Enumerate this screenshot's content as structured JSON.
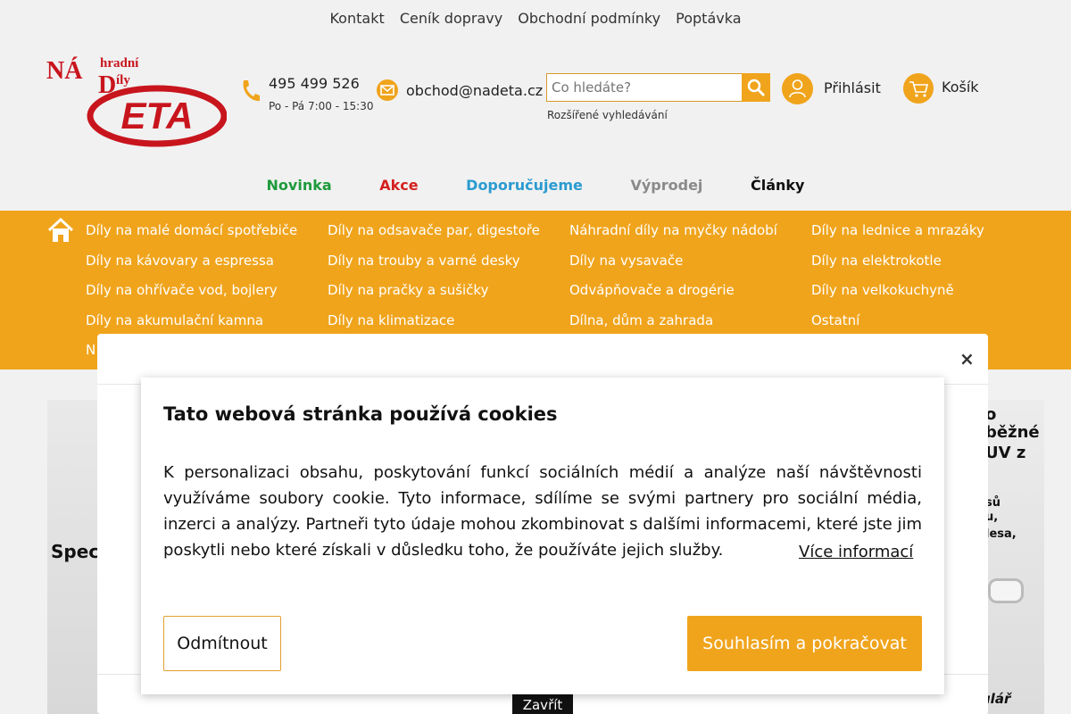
{
  "top_links": [
    "Kontakt",
    "Ceník dopravy",
    "Obchodní podmínky",
    "Poptávka"
  ],
  "logo": {
    "line1": "NÁ",
    "line2": "hradní",
    "line3": "D",
    "line4": "íly",
    "brand": "ETA"
  },
  "contact": {
    "phone": "495 499 526",
    "hours": "Po - Pá 7:00 - 15:30",
    "email": "obchod@nadeta.cz"
  },
  "search": {
    "placeholder": "Co hledáte?",
    "advanced": "Rozšířené vyhledávání"
  },
  "account": {
    "login": "Přihlásit",
    "cart": "Košík"
  },
  "nav": [
    {
      "label": "Novinka",
      "color": "#1e9a3c"
    },
    {
      "label": "Akce",
      "color": "#d52020"
    },
    {
      "label": "Doporučujeme",
      "color": "#2a9bd0"
    },
    {
      "label": "Výprodej",
      "color": "#8a8a8a"
    },
    {
      "label": "Články",
      "color": "#111111"
    }
  ],
  "categories": [
    [
      "Díly na malé domácí spotřebiče",
      "Díly na kávovary a espressa",
      "Díly na ohřívače vod, bojlery",
      "Díly na akumulační kamna",
      "N"
    ],
    [
      "Díly na odsavače par, digestoře",
      "Díly na trouby a varné desky",
      "Díly na pračky a sušičky",
      "Díly na klimatizace"
    ],
    [
      "Náhradní díly na myčky nádobí",
      "Díly na vysavače",
      "Odvápňovače a drogérie",
      "Dílna, dům a zahrada"
    ],
    [
      "Díly na lednice a mrazáky",
      "Díly na elektrokotle",
      "Díly na velkokuchyně",
      "Ostatní"
    ]
  ],
  "background": {
    "left_text": "Spec",
    "right_lines": [
      "o",
      "běžné",
      "UV z",
      "sů",
      "u,",
      "lesa,",
      "ulář"
    ]
  },
  "modal": {
    "close_x": "×",
    "close_button": "Zavřít"
  },
  "cookie": {
    "title": "Tato webová stránka používá cookies",
    "text": "K personalizaci obsahu, poskytování funkcí sociálních médií a analýze naší návštěvnosti využíváme soubory cookie. Tyto informace, sdílíme se svými partnery pro sociální média, inzerci a analýzy. Partneři tyto údaje mohou zkombinovat s dalšími informacemi, které jste jim poskytli nebo které získali v důsledku toho, že používáte jejich služby.",
    "more_info": "Více informací",
    "decline": "Odmítnout",
    "accept": "Souhlasím a pokračovat"
  },
  "colors": {
    "accent": "#f0a41c",
    "logo_red": "#c8151d"
  }
}
